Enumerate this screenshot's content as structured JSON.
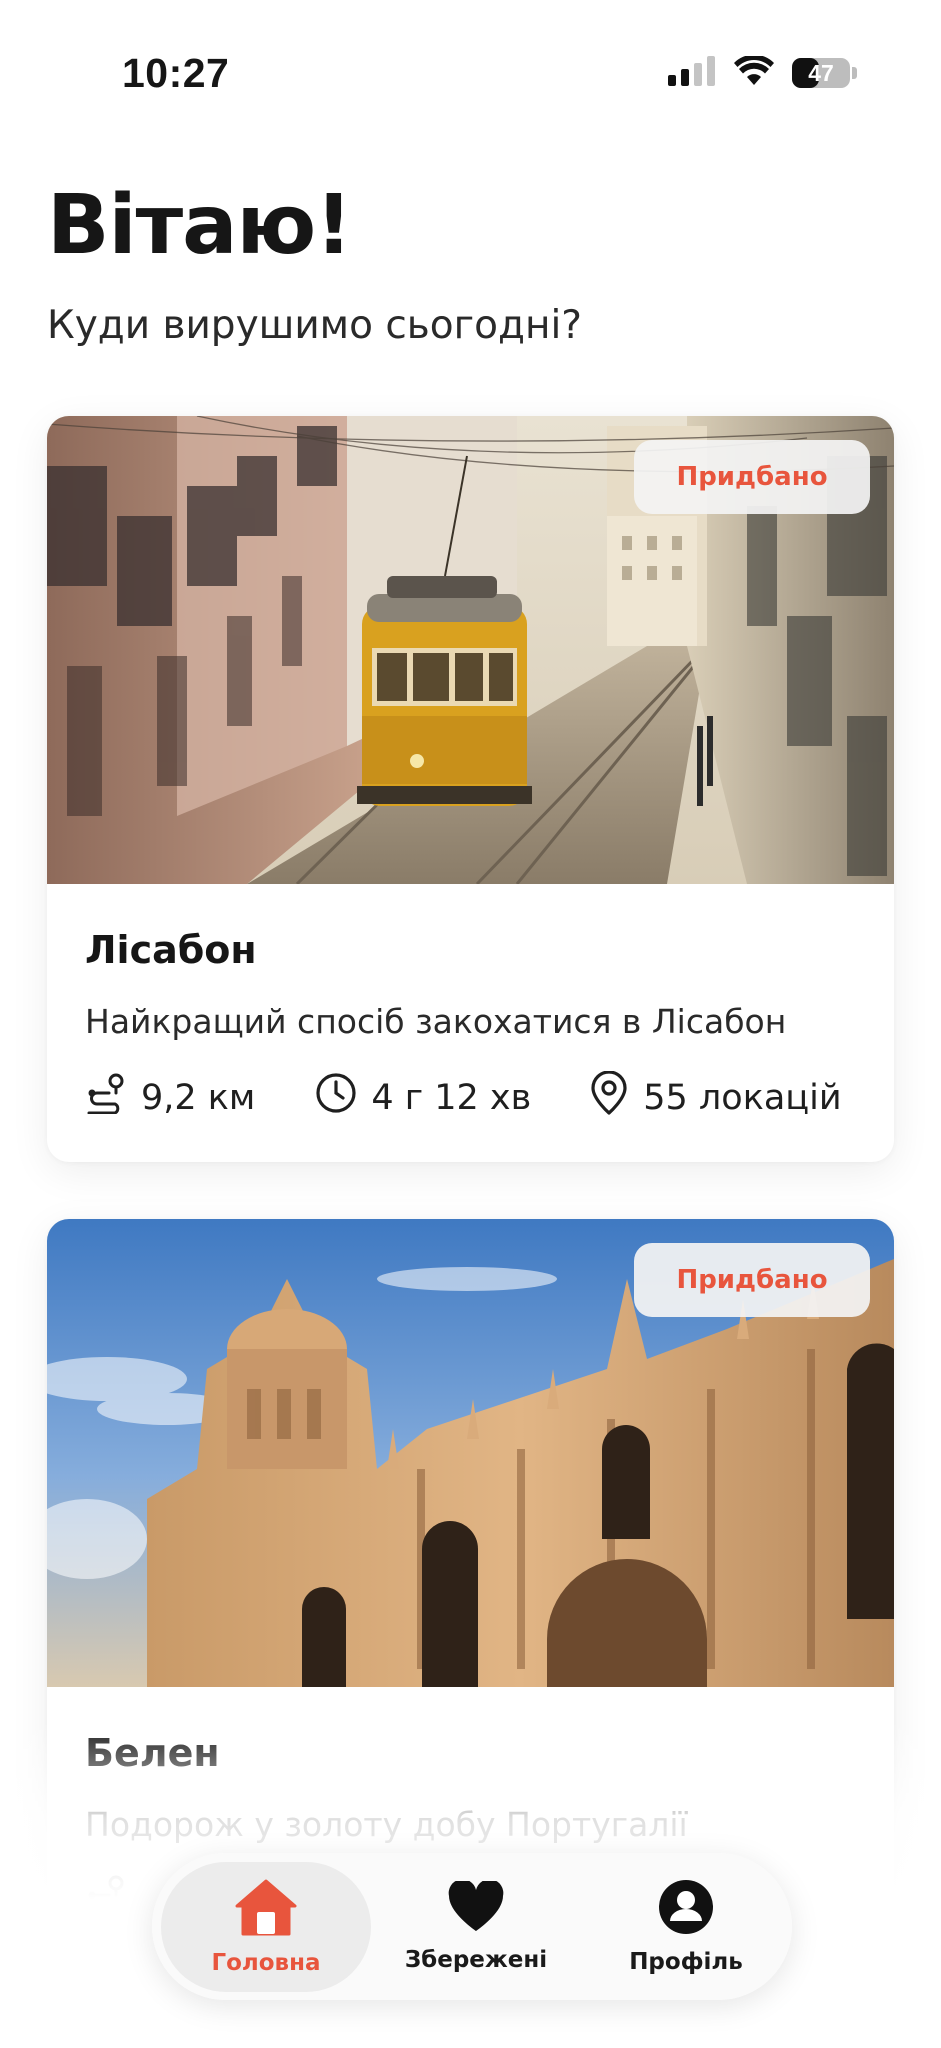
{
  "status_bar": {
    "time": "10:27",
    "battery_level": "47",
    "battery_fraction": 0.47,
    "icons": [
      "cellular-signal-icon",
      "wifi-icon",
      "battery-icon"
    ]
  },
  "header": {
    "greeting": "Вітаю!",
    "subtitle": "Куди вирушимо сьогодні?"
  },
  "colors": {
    "accent": "#e8553d",
    "text": "#161616",
    "badge_bg": "#f3f3f3"
  },
  "tours": [
    {
      "image": "lisbon-tram-street-photo",
      "badge": "Придбано",
      "title": "Лісабон",
      "description": "Найкращий спосіб закохатися в Лісабон",
      "distance": "9,2 км",
      "duration": "4 г 12 хв",
      "locations": "55 локацій"
    },
    {
      "image": "belem-monastery-photo",
      "badge": "Придбано",
      "title": "Белен",
      "description": "Подорож у золоту добу Португалії",
      "distance": "",
      "duration": "",
      "locations": ""
    }
  ],
  "tab_bar": {
    "tabs": [
      {
        "label": "Головна",
        "icon": "home-icon",
        "active": true
      },
      {
        "label": "Збережені",
        "icon": "heart-icon",
        "active": false
      },
      {
        "label": "Профіль",
        "icon": "profile-icon",
        "active": false
      }
    ]
  }
}
